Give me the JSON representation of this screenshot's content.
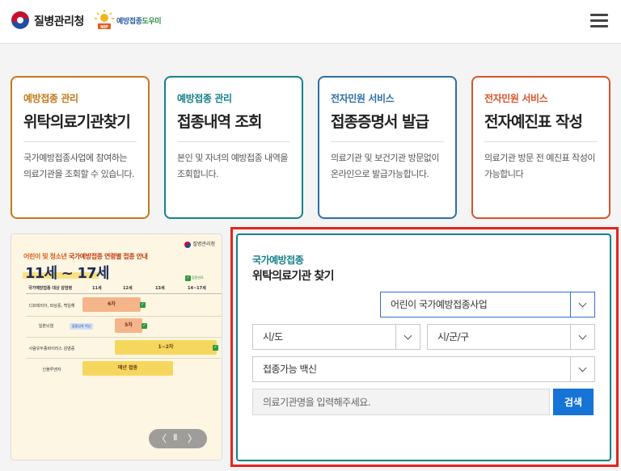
{
  "header": {
    "kdca_name": "질병관리청",
    "nip_name_main": "예방접종",
    "nip_name_accent": "도우미",
    "colors": {
      "kdca_red": "#c8102e",
      "kdca_blue": "#1e4fa3",
      "nip_blue": "#2a5aa8",
      "nip_green": "#2c8f3c"
    }
  },
  "cards": [
    {
      "category": "예방접종 관리",
      "title": "위탁의료기관찾기",
      "desc": "국가예방접종사업에 참여하는 의료기관을 조회할 수 있습니다.",
      "color": "#c27a1a"
    },
    {
      "category": "예방접종 관리",
      "title": "접종내역 조회",
      "desc": "본인 및 자녀의 예방접종 내역을 조회합니다.",
      "color": "#16818a"
    },
    {
      "category": "전자민원 서비스",
      "title": "접종증명서 발급",
      "desc": "의료기관 및 보건기관 방문없이 온라인으로 발급가능합니다.",
      "color": "#2d6fa8"
    },
    {
      "category": "전자민원 서비스",
      "title": "전자예진표 작성",
      "desc": "의료기관 방문 전 예진표 작성이 가능합니다",
      "color": "#d9532a"
    }
  ],
  "banner": {
    "logo_text": "질병관리청",
    "subtitle_a": "어린이 및 청소년 ",
    "subtitle_b": "국가예방접종 연령별 접종 안내",
    "main": "11세 ~ 17세",
    "legend": "접종완료",
    "headers": [
      "국가예방접종 대상 감염병",
      "11세",
      "12세",
      "13세",
      "14~17세"
    ],
    "rows": [
      {
        "label": "디프테리아, 파상풍, 백일해",
        "bar": "6차"
      },
      {
        "label": "일본뇌염",
        "tag": "불활성화 백신",
        "bar": "5차"
      },
      {
        "label": "사람유두종바이러스 감염증",
        "bar": "1~2차"
      },
      {
        "label": "인플루엔자",
        "bar": "매년 접종"
      }
    ],
    "controls": {
      "prev": "〈",
      "pause": "Ⅱ",
      "next": "〉"
    }
  },
  "search_panel": {
    "category": "국가예방접종",
    "title": "위탁의료기관 찾기",
    "program_select": "어린이 국가예방접종사업",
    "sido_select": "시/도",
    "sigungu_select": "시/군/구",
    "vaccine_select": "접종가능 백신",
    "input_placeholder": "의료기관명을 입력해주세요.",
    "search_button": "검색",
    "accent_color": "#16818a",
    "button_color": "#1674d6",
    "highlight_color": "#e0261f"
  }
}
